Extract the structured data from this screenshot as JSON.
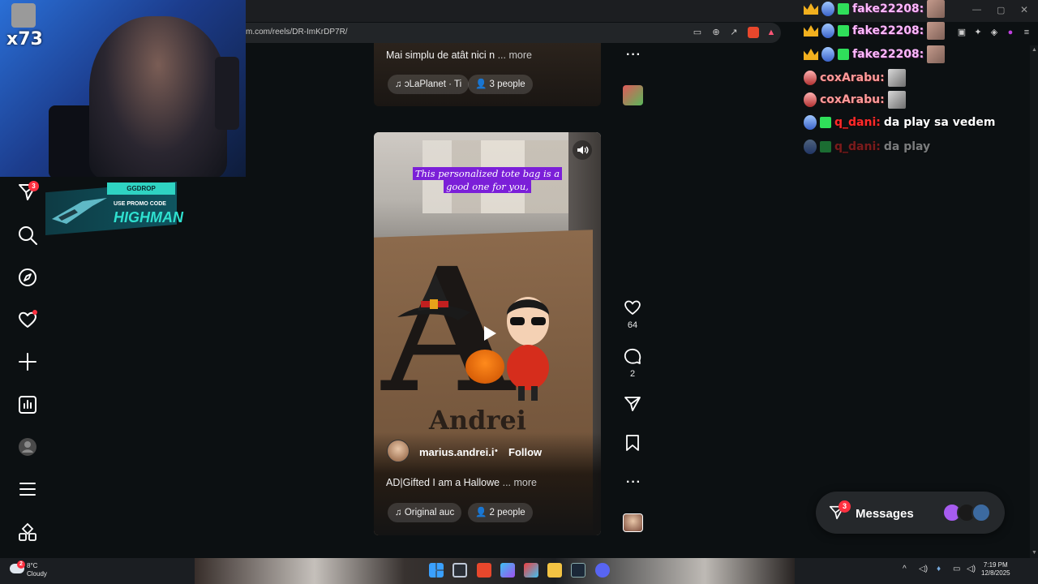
{
  "browser": {
    "url": "m.com/reels/DR-ImKrDP7R/"
  },
  "webcam": {
    "counter": "x73"
  },
  "promo": {
    "brand": "GGDROP",
    "line": "USE PROMO CODE",
    "code": "HIGHMAN"
  },
  "nav": {
    "messages_badge": "3",
    "items": [
      "home",
      "search",
      "explore",
      "notifications",
      "create",
      "dashboard",
      "profile",
      "more",
      "also-from-meta"
    ]
  },
  "reel_top": {
    "caption": "Mai simplu de atât nici n",
    "more": "... more",
    "audio": "ɔLaPlanet · Ti",
    "people": "3 people"
  },
  "reel_main": {
    "overlay_text": "This personalized tote bag is a good one for you,",
    "box_name": "Andrei",
    "username": "marius.andrei.i",
    "separator": "•",
    "follow": "Follow",
    "caption": "AD|Gifted I am a Hallowe",
    "more": "... more",
    "audio": "Original auc",
    "people": "2 people",
    "likes": "64",
    "comments": "2"
  },
  "chat": [
    {
      "user": "fake22208:",
      "type": "fake"
    },
    {
      "user": "fake22208:",
      "type": "fake"
    },
    {
      "user": "fake22208:",
      "type": "fake"
    },
    {
      "user": "coxArabu:",
      "type": "cox"
    },
    {
      "user": "coxArabu:",
      "type": "cox"
    },
    {
      "user": "q_dani:",
      "type": "dani",
      "message": "da play sa vedem"
    },
    {
      "user": "q_dani:",
      "type": "dani",
      "message": "da play"
    }
  ],
  "messages_pill": {
    "label": "Messages",
    "badge": "3"
  },
  "taskbar": {
    "temp": "8°C",
    "weather": "Cloudy",
    "weather_badge": "2",
    "time": "7:19 PM",
    "date": "12/8/2025"
  },
  "colors": {
    "accent_red": "#ff3040",
    "overlay_purple": "#7b1fd8",
    "chat_pink": "#ffb8ff",
    "chat_red": "#ff2a2a"
  }
}
